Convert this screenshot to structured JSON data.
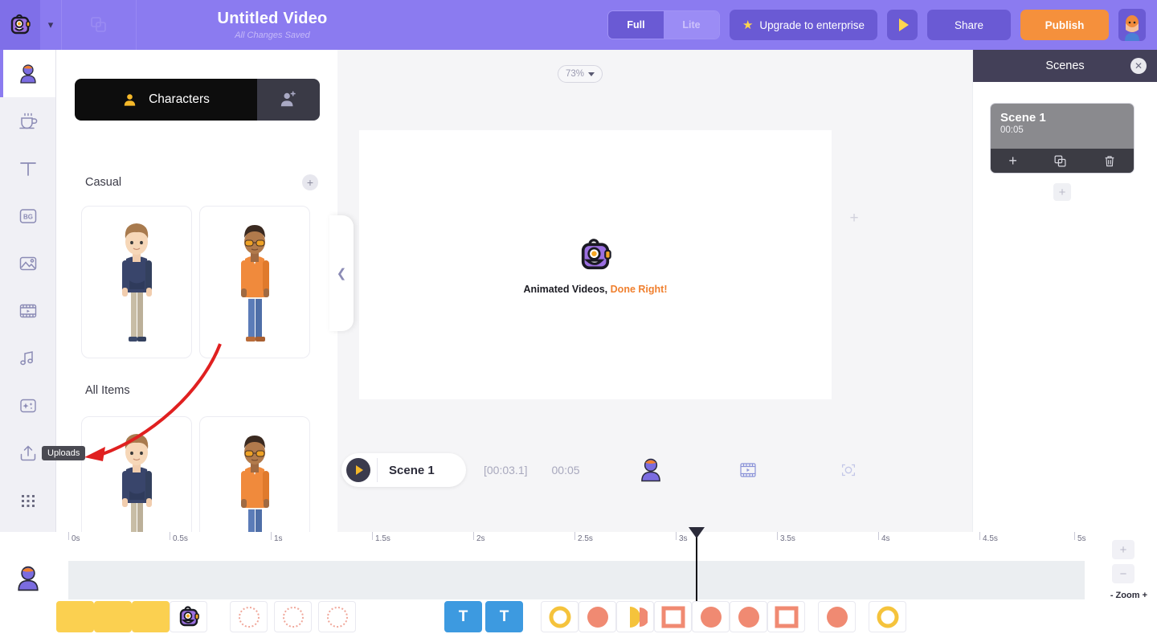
{
  "header": {
    "logo_icon": "monster-logo-icon",
    "chevron_icon": "chevron-down-icon",
    "duplicate_icon": "duplicate-icon",
    "title": "Untitled Video",
    "subtitle": "All Changes Saved",
    "mode_toggle": {
      "full": "Full",
      "lite": "Lite",
      "selected": "Full"
    },
    "upgrade_label": "Upgrade to enterprise",
    "upgrade_icon": "star-icon",
    "preview_icon": "play-icon",
    "share_label": "Share",
    "publish_label": "Publish",
    "avatar_icon": "user-avatar-icon",
    "accent_bg": "#8b7bf0",
    "publish_color": "#f5903c"
  },
  "rail": {
    "items": [
      {
        "name": "characters",
        "icon": "character-icon",
        "active": true
      },
      {
        "name": "props",
        "icon": "cup-icon",
        "active": false
      },
      {
        "name": "text",
        "icon": "text-t-icon",
        "active": false
      },
      {
        "name": "background",
        "icon": "bg-icon",
        "active": false
      },
      {
        "name": "images",
        "icon": "image-icon",
        "active": false
      },
      {
        "name": "video",
        "icon": "film-icon",
        "active": false
      },
      {
        "name": "music",
        "icon": "music-note-icon",
        "active": false
      },
      {
        "name": "effects",
        "icon": "sparkle-icon",
        "active": false
      },
      {
        "name": "uploads",
        "icon": "upload-icon",
        "active": false
      },
      {
        "name": "apps",
        "icon": "grid-apps-icon",
        "active": false
      }
    ],
    "tooltip": "Uploads",
    "bottom_avatar_icon": "character-avatar-icon"
  },
  "panel": {
    "tab_label": "Characters",
    "tab_icon": "person-icon",
    "add_character_icon": "person-plus-icon",
    "sections": [
      {
        "title": "Casual",
        "add_icon": "plus-icon"
      },
      {
        "title": "All Items",
        "add_icon": ""
      }
    ],
    "collapse_icon": "chevron-left-icon"
  },
  "stage": {
    "zoom_level": "73%",
    "zoom_caret_icon": "caret-down-icon",
    "logo_icon": "monster-logo-icon",
    "tagline_dark": "Animated Videos,",
    "tagline_accent": "Done Right!",
    "accent_color": "#f0802f",
    "add_icon": "plus-icon"
  },
  "playbar": {
    "play_icon": "play-icon",
    "scene_name": "Scene 1",
    "current_time": "[00:03.1]",
    "total_time": "00:05",
    "tools": [
      {
        "name": "character-track",
        "icon": "character-icon"
      },
      {
        "name": "video-track",
        "icon": "film-icon"
      },
      {
        "name": "camera-track",
        "icon": "camera-frame-icon"
      }
    ]
  },
  "timeline": {
    "ticks": [
      "0s",
      "0.5s",
      "1s",
      "1.5s",
      "2s",
      "2.5s",
      "3s",
      "3.5s",
      "4s",
      "4.5s",
      "5s"
    ],
    "playhead_time": "3s",
    "zoom_in_icon": "plus-icon",
    "zoom_out_icon": "minus-icon",
    "zoom_minus": "-",
    "zoom_label": "Zoom",
    "zoom_plus": "+"
  },
  "filmstrip": {
    "cells": [
      {
        "kind": "yellow"
      },
      {
        "kind": "yellow"
      },
      {
        "kind": "yellow"
      },
      {
        "kind": "logo"
      },
      {
        "kind": "dashed-circle"
      },
      {
        "kind": "dashed-circle"
      },
      {
        "kind": "dashed-circle"
      },
      {
        "kind": "text",
        "label": "T"
      },
      {
        "kind": "text",
        "label": "T"
      },
      {
        "kind": "ring"
      },
      {
        "kind": "half-circle"
      },
      {
        "kind": "half-circle"
      },
      {
        "kind": "square-outline"
      },
      {
        "kind": "half-circle"
      },
      {
        "kind": "half-circle"
      },
      {
        "kind": "square-outline"
      },
      {
        "kind": "circle"
      },
      {
        "kind": "ring"
      }
    ]
  },
  "scenes": {
    "title": "Scenes",
    "close_icon": "close-icon",
    "items": [
      {
        "name": "Scene 1",
        "duration": "00:05",
        "tools": [
          {
            "name": "add-scene",
            "icon": "plus-icon"
          },
          {
            "name": "duplicate-scene",
            "icon": "duplicate-icon"
          },
          {
            "name": "delete-scene",
            "icon": "trash-icon"
          }
        ]
      }
    ],
    "add_scene_icon": "plus-icon"
  },
  "annotation": {
    "arrow_color": "#e02020",
    "points_to": "Uploads"
  }
}
